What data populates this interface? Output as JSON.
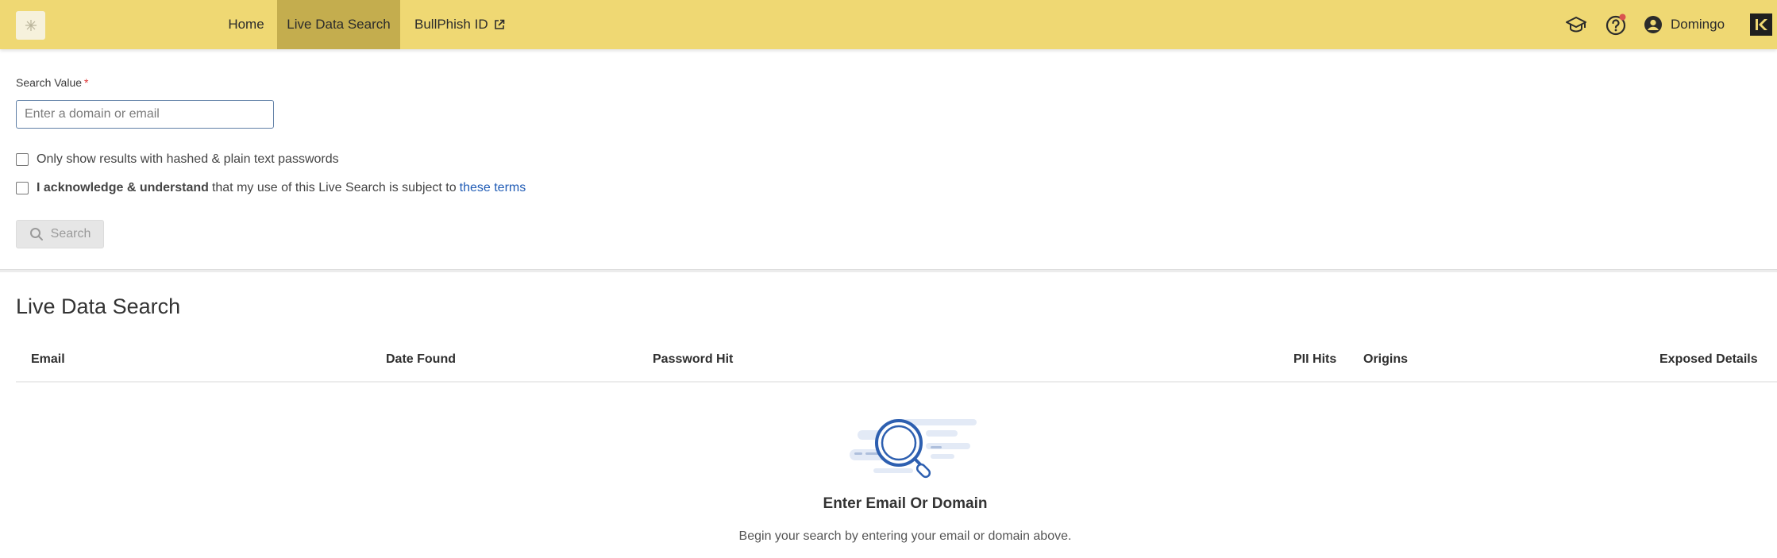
{
  "nav": {
    "home": "Home",
    "live_data_search": "Live Data Search",
    "bullphish_id": "BullPhish ID"
  },
  "header": {
    "user_name": "Domingo",
    "icons": [
      "graduation-cap-icon",
      "help-icon",
      "account-icon",
      "kaseya-logo-icon"
    ],
    "notification_dot_color": "#d9534f"
  },
  "form": {
    "search_label": "Search Value",
    "required_marker": "*",
    "search_placeholder": "Enter a domain or email",
    "search_value": "",
    "checkbox_passwords_label": "Only show results with hashed & plain text passwords",
    "checkbox_passwords_checked": false,
    "ack_bold": "I acknowledge & understand",
    "ack_text": "that my use of this Live Search is subject to",
    "ack_link": "these terms",
    "ack_checked": false,
    "search_button": "Search"
  },
  "results": {
    "title": "Live Data Search",
    "columns": [
      "Email",
      "Date Found",
      "Password Hit",
      "PII Hits",
      "Origins",
      "Exposed Details"
    ],
    "empty_title": "Enter Email Or Domain",
    "empty_description": "Begin your search by entering your email or domain above."
  },
  "colors": {
    "topbar": "#efd873",
    "active_tab": "#c4ad4e",
    "link": "#1f5bb5",
    "accent_blue": "#2d5fb0"
  }
}
